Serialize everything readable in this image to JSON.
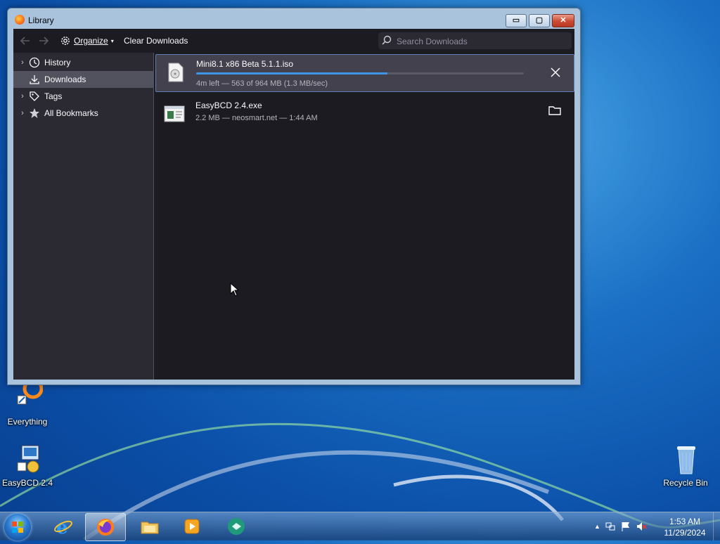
{
  "desktop": {
    "icons": [
      {
        "label": "Everything"
      },
      {
        "label": "EasyBCD 2.4"
      },
      {
        "label": "Recycle Bin"
      }
    ]
  },
  "window": {
    "title": "Library",
    "controls": {
      "minimize": "▭",
      "maximize": "▢",
      "close": "✕"
    }
  },
  "toolbar": {
    "organize_label": "Organize",
    "clear_label": "Clear Downloads",
    "search_placeholder": "Search Downloads"
  },
  "sidebar": {
    "items": [
      {
        "label": "History",
        "icon": "clock-icon",
        "selected": false
      },
      {
        "label": "Downloads",
        "icon": "download-icon",
        "selected": true
      },
      {
        "label": "Tags",
        "icon": "tag-icon",
        "selected": false
      },
      {
        "label": "All Bookmarks",
        "icon": "star-icon",
        "selected": false
      }
    ]
  },
  "downloads": [
    {
      "name": "Mini8.1 x86 Beta 5.1.1.iso",
      "status": "4m left — 563 of 964 MB (1.3 MB/sec)",
      "progress": 0.584,
      "action": "cancel",
      "selected": true
    },
    {
      "name": "EasyBCD 2.4.exe",
      "status": "2.2 MB — neosmart.net — 1:44 AM",
      "action": "open-folder",
      "selected": false
    }
  ],
  "taskbar": {
    "apps": [
      "internet-explorer-icon",
      "firefox-icon",
      "file-explorer-icon",
      "media-player-icon",
      "easybcd-icon"
    ],
    "active_app": "firefox-icon",
    "clock": {
      "time": "1:53 AM",
      "date": "11/29/2024"
    }
  },
  "colors": {
    "accent": "#3e95e6",
    "window_bg": "#1c1b22",
    "sidebar_bg": "#2b2a33"
  }
}
